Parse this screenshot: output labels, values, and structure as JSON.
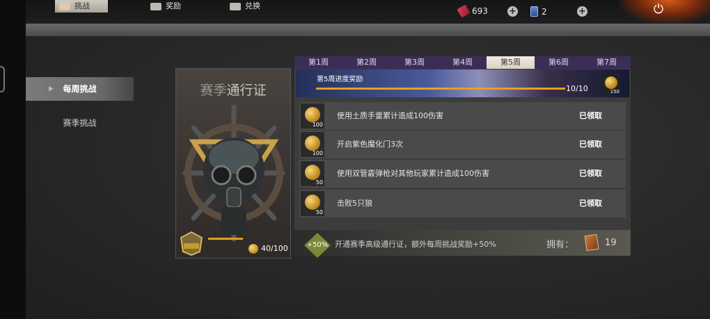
{
  "resources": {
    "tickets": "693",
    "cards": "2"
  },
  "nav": {
    "tabs": [
      {
        "label": "挑战"
      },
      {
        "label": "奖励"
      },
      {
        "label": "兑换"
      }
    ]
  },
  "sidebar": {
    "items": [
      {
        "label": "每周挑战"
      },
      {
        "label": "赛季挑战"
      }
    ]
  },
  "pass": {
    "title_prefix": "赛季",
    "title": "通行证",
    "progress_text": "40/100",
    "progress_fraction": 0.4
  },
  "weeks": [
    "第1周",
    "第2周",
    "第3周",
    "第4周",
    "第5周",
    "第6周",
    "第7周"
  ],
  "active_week_index": 4,
  "banner": {
    "title": "第5周进度奖励",
    "count": "10/10",
    "reward_count": "150"
  },
  "tasks": [
    {
      "text": "使用土质手雷累计造成100伤害",
      "reward": "100",
      "status": "已领取"
    },
    {
      "text": "开启紫色魔化门3次",
      "reward": "100",
      "status": "已领取"
    },
    {
      "text": "使用双管霰弹枪对其他玩家累计造成100伤害",
      "reward": "50",
      "status": "已领取"
    },
    {
      "text": "击败5只狼",
      "reward": "50",
      "status": "已领取"
    }
  ],
  "footer": {
    "badge": "+50%",
    "text": "开通赛季高级通行证，额外每周挑战奖励+50%",
    "own_label": "拥有：",
    "own_count": "19"
  },
  "colors": {
    "accent_gold": "#e6a21e",
    "week_tab_bg": "#3a2e58"
  }
}
